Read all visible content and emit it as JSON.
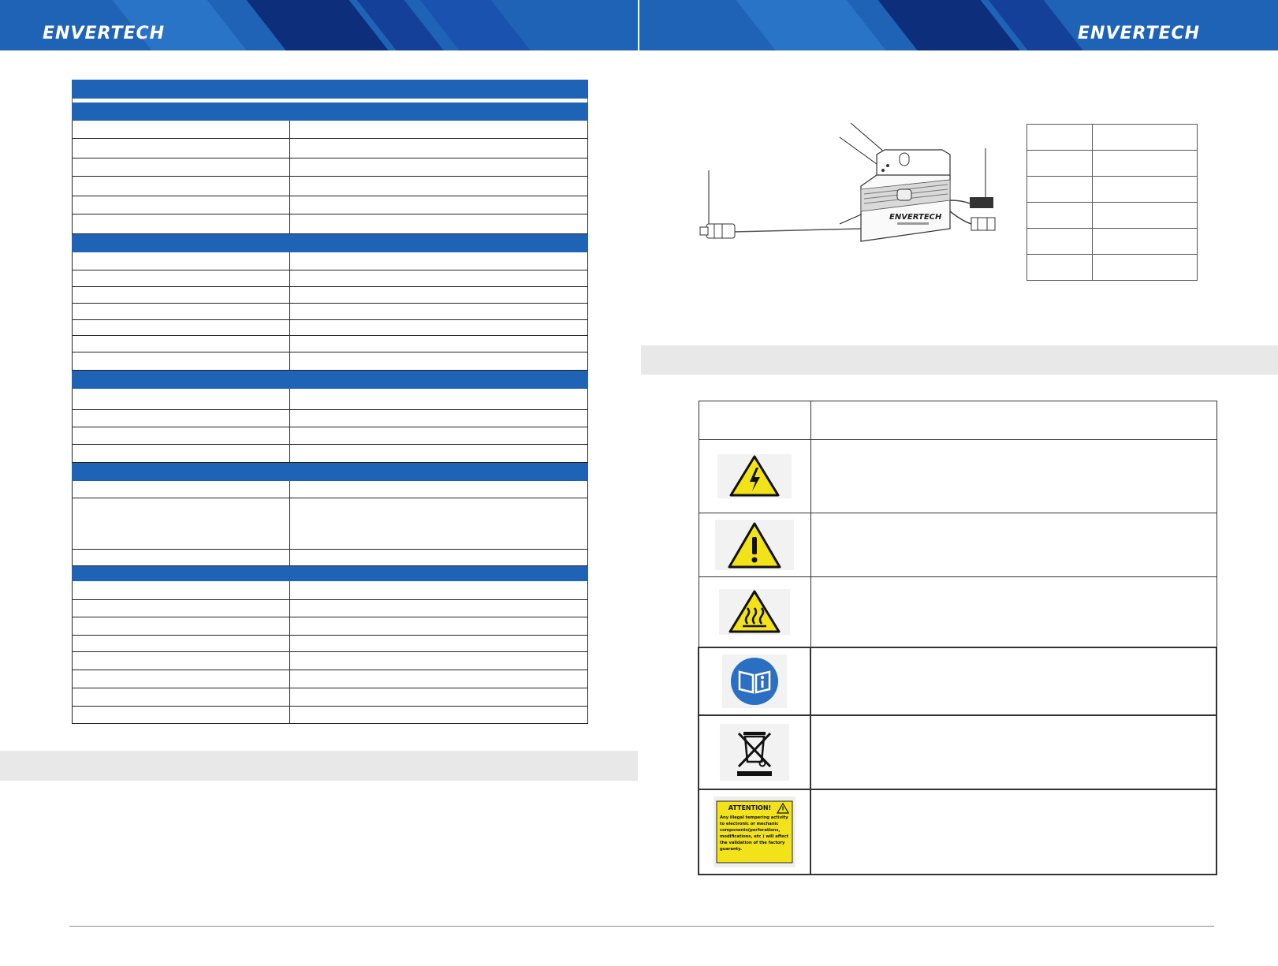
{
  "header": {
    "left_logo": "ENVERTECH",
    "right_logo": "ENVERTECH"
  },
  "colors": {
    "brand_blue": "#1f63b7",
    "dark_blue": "#0d2e7a",
    "grey_bar": "#e8e8e8",
    "warning_yellow": "#f2e21a"
  },
  "product": {
    "brand_label": "ENVERTECH"
  },
  "symbols": [
    {
      "icon": "electric-shock-warning-icon"
    },
    {
      "icon": "general-warning-icon"
    },
    {
      "icon": "hot-surface-warning-icon"
    },
    {
      "icon": "read-manual-icon"
    },
    {
      "icon": "weee-crossed-bin-icon"
    },
    {
      "icon": "attention-tampering-label-icon",
      "lines": [
        "ATTENTION!",
        "Any illegal tempering activity",
        "to electronic or mechanic",
        "components(perforations,",
        "modifications, etc ) will affect",
        "the validation of the factory",
        "guaranty."
      ]
    }
  ]
}
